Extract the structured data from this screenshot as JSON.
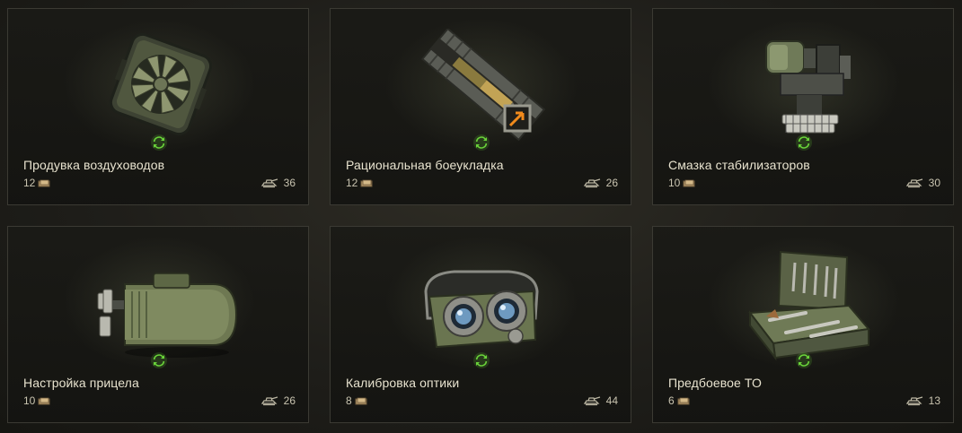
{
  "accent_color": "#6ad43a",
  "icons": {
    "cost": "bond-icon",
    "slots": "tank-icon",
    "action": "refresh-icon"
  },
  "cards": [
    {
      "title": "Продувка воздуховодов",
      "cost": "12",
      "count": "36",
      "image": "fan-icon"
    },
    {
      "title": "Рациональная боеукладка",
      "cost": "12",
      "count": "26",
      "image": "ammo-rack-icon"
    },
    {
      "title": "Смазка стабилизаторов",
      "cost": "10",
      "count": "30",
      "image": "stabilizer-icon"
    },
    {
      "title": "Настройка прицела",
      "cost": "10",
      "count": "26",
      "image": "motor-icon"
    },
    {
      "title": "Калибровка оптики",
      "cost": "8",
      "count": "44",
      "image": "binocular-icon"
    },
    {
      "title": "Предбоевое ТО",
      "cost": "6",
      "count": "13",
      "image": "toolbox-icon"
    }
  ]
}
